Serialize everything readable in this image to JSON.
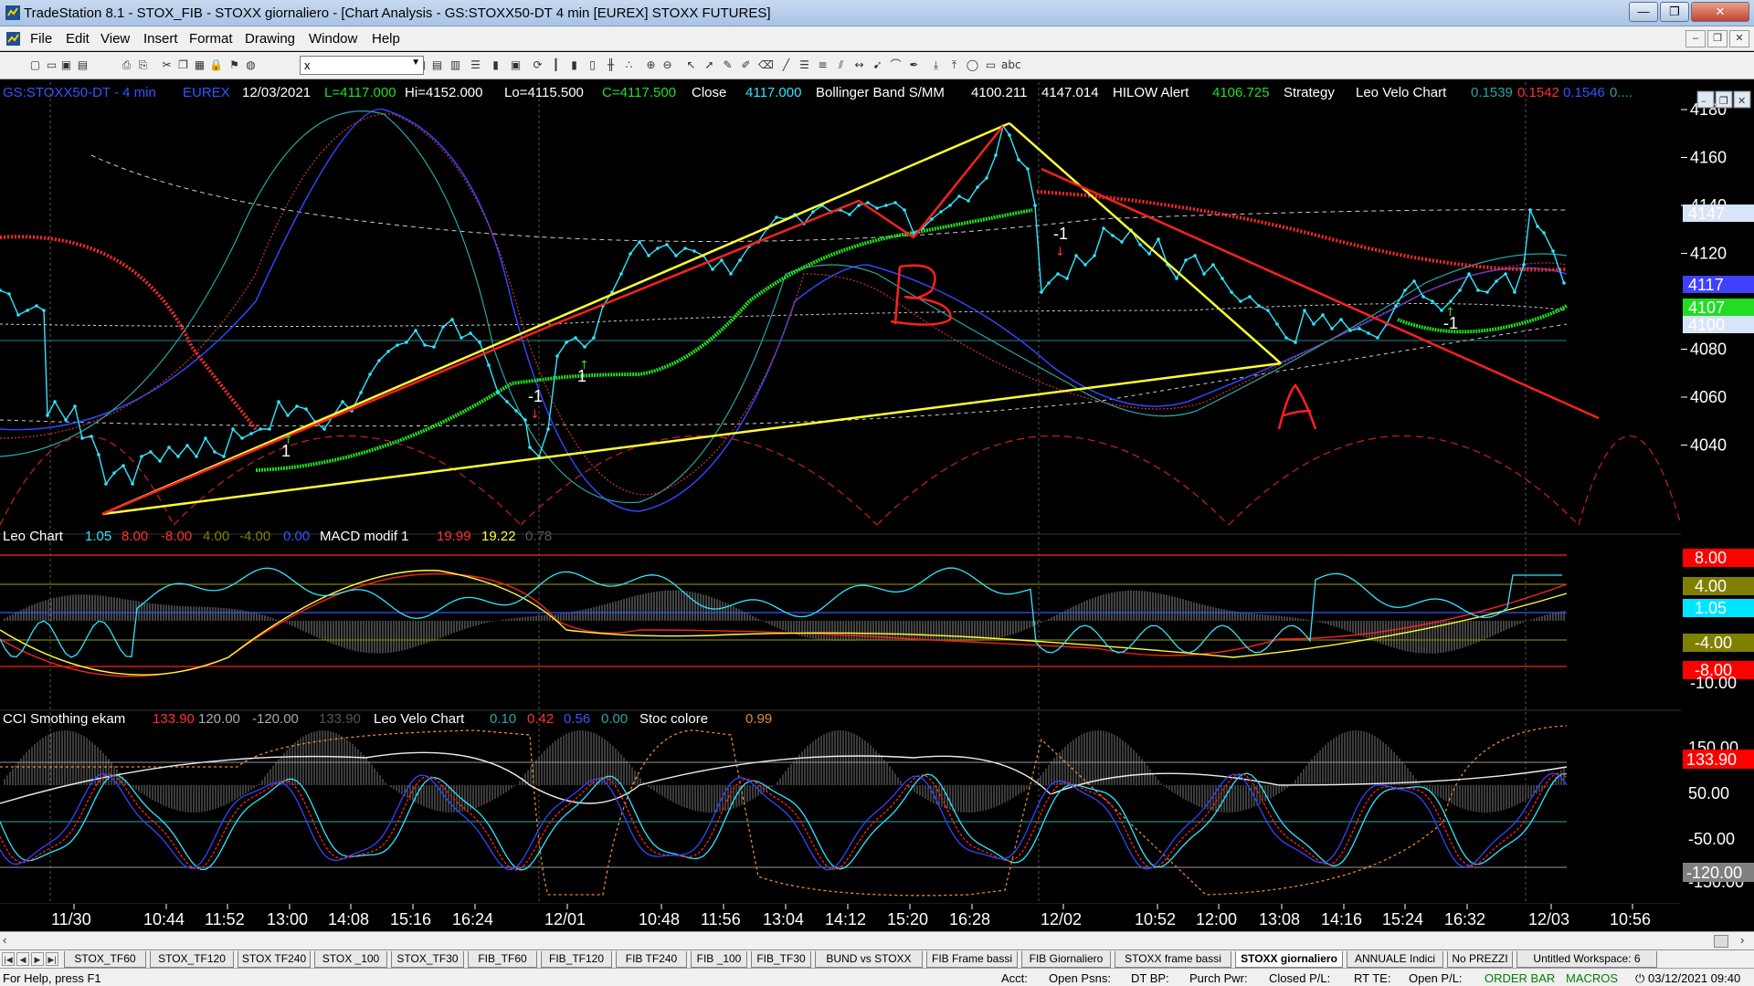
{
  "window": {
    "title": "TradeStation 8.1 - STOX_FIB - STOXX giornaliero - [Chart Analysis - GS:STOXX50-DT  4 min  [EUREX] STOXX FUTURES]",
    "minimize_glyph": "—",
    "maximize_glyph": "❐",
    "close_glyph": "✕"
  },
  "menu": {
    "items": [
      "File",
      "Edit",
      "View",
      "Insert",
      "Format",
      "Drawing",
      "Window",
      "Help"
    ],
    "mdi": [
      "–",
      "❐",
      "✕"
    ]
  },
  "toolbar": {
    "symbol_value": "x",
    "icons": [
      "new-icon",
      "open-icon",
      "save-icon",
      "folder-icon",
      "print-icon",
      "print-preview-icon",
      "cut-icon",
      "copy-icon",
      "paste-icon",
      "lock-icon",
      "flag-icon",
      "globe-icon",
      "symbol-dropdown",
      "arrow-right-icon",
      "search-icon",
      "grid-icon",
      "table-icon",
      "book-icon",
      "list-icon",
      "chart-icon",
      "window-icon",
      "refresh-icon",
      "bar-icon",
      "bar-chart-icon",
      "candle-icon",
      "tick-icon",
      "dots-icon",
      "zoom-in-icon",
      "zoom-out-icon",
      "cursor-icon",
      "pointer-icon",
      "tools-icon",
      "drawing-icon",
      "delete-icon",
      "trendline-icon",
      "horizontal-line-icon",
      "fib-icon",
      "channel-icon",
      "arrow-icon",
      "speed-icon",
      "arc-icon",
      "pen-icon",
      "arrow-down-icon",
      "arrow-up-icon",
      "ellipse-icon",
      "rectangle-icon",
      "text-icon"
    ]
  },
  "chart": {
    "header": {
      "symbol": "GS:STOXX50-DT - 4 min",
      "exchange": "EUREX",
      "date": "12/03/2021",
      "last": "L=4117.000",
      "high": "Hi=4152.000",
      "low": "Lo=4115.500",
      "close_val": "C=4117.500",
      "close_label": "Close",
      "close_num": "4117.000",
      "bb_label": "Bollinger Band S/MM",
      "bb_v1": "4100.211",
      "bb_v2": "4147.014",
      "hilow_label": "HILOW Alert",
      "hilow_v": "4106.725",
      "strategy": "Strategy",
      "leo_label": "Leo Velo Chart",
      "leo_v1": "0.1539",
      "leo_v2": "0.1542",
      "leo_v3": "0.1546",
      "leo_v4": "0...."
    },
    "price_axis": {
      "ticks": [
        "4180",
        "4160",
        "4140",
        "4120",
        "4080",
        "4060",
        "4040"
      ],
      "tags": [
        {
          "text": "4147",
          "bg": "#d8e4f8",
          "fg": "#000000"
        },
        {
          "text": "4117",
          "bg": "#4040ff",
          "fg": "#ffffff"
        },
        {
          "text": "4107",
          "bg": "#22dd22",
          "fg": "#000000"
        },
        {
          "text": "4100",
          "bg": "#d8e4f8",
          "fg": "#000000"
        }
      ]
    },
    "annotations": {
      "b": "B",
      "a": "A",
      "sig1": "-1",
      "sig2": "-1",
      "sig3": "1",
      "sig4": "1",
      "sig5": "-1"
    },
    "macd_panel": {
      "leo": "Leo Chart",
      "v1": "1.05",
      "v2": "8.00",
      "v3": "-8.00",
      "v4": "4.00",
      "v5": "-4.00",
      "v6": "0.00",
      "macd_label": "MACD modif 1",
      "m1": "19.99",
      "m2": "19.22",
      "m3": "0.78",
      "axis_tags": [
        {
          "text": "8.00",
          "bg": "#ff0000",
          "fg": "#ffffff"
        },
        {
          "text": "4.00",
          "bg": "#808000",
          "fg": "#ffffff"
        },
        {
          "text": "1.05",
          "bg": "#00e5ff",
          "fg": "#000000"
        },
        {
          "text": "-4.00",
          "bg": "#808000",
          "fg": "#ffffff"
        },
        {
          "text": "-8.00",
          "bg": "#ff0000",
          "fg": "#ffffff"
        }
      ],
      "tick": "-10.00"
    },
    "cci_panel": {
      "cci_label": "CCI Smothing ekam",
      "c1": "133.90",
      "c2": "120.00",
      "c3": "-120.00",
      "c4": "133.90",
      "leo_label": "Leo Velo Chart",
      "l1": "0.10",
      "l2": "0.42",
      "l3": "0.56",
      "l4": "0.00",
      "stoc_label": "Stoc colore",
      "s1": "0.99",
      "ticks": [
        "150.00",
        "50.00",
        "-50.00",
        "-150.00"
      ],
      "tags": [
        {
          "text": "133.90",
          "bg": "#ff0000",
          "fg": "#000000"
        },
        {
          "text": "-120.00",
          "bg": "#808080",
          "fg": "#000000"
        }
      ]
    },
    "time_axis": [
      "11/30",
      "10:44",
      "11:52",
      "13:00",
      "14:08",
      "15:16",
      "16:24",
      "12/01",
      "10:48",
      "11:56",
      "13:04",
      "14:12",
      "15:20",
      "16:28",
      "12/02",
      "10:52",
      "12:00",
      "13:08",
      "14:16",
      "15:24",
      "16:32",
      "12/03",
      "10:56"
    ]
  },
  "tabs": [
    "STOX_TF60",
    "STOX_TF120",
    "STOX TF240",
    "STOX _100",
    "STOX_TF30",
    "FIB_TF60",
    "FIB_TF120",
    "FIB TF240",
    "FIB _100",
    "FIB_TF30",
    "BUND vs STOXX",
    "FIB Frame bassi",
    "FIB Giornaliero",
    "STOXX frame bassi",
    "STOXX giornaliero",
    "ANNUALE Indici",
    "No PREZZI",
    "Untitled Workspace: 6"
  ],
  "active_tab": "STOXX giornaliero",
  "status": {
    "help": "For Help, press F1",
    "acct": "Acct:",
    "open_psns": "Open Psns:",
    "dt_bp": "DT BP:",
    "purch_pwr": "Purch Pwr:",
    "closed_pl": "Closed P/L:",
    "rt_te": "RT TE:",
    "open_pl": "Open P/L:",
    "order_bar": "ORDER BAR",
    "macros": "MACROS",
    "datetime": "03/12/2021 09:40"
  },
  "colors": {
    "price": "#2ee6ff",
    "support": "#ffff33",
    "trend": "#ff2020",
    "ma_green": "#22dd22",
    "bg": "#000000"
  }
}
